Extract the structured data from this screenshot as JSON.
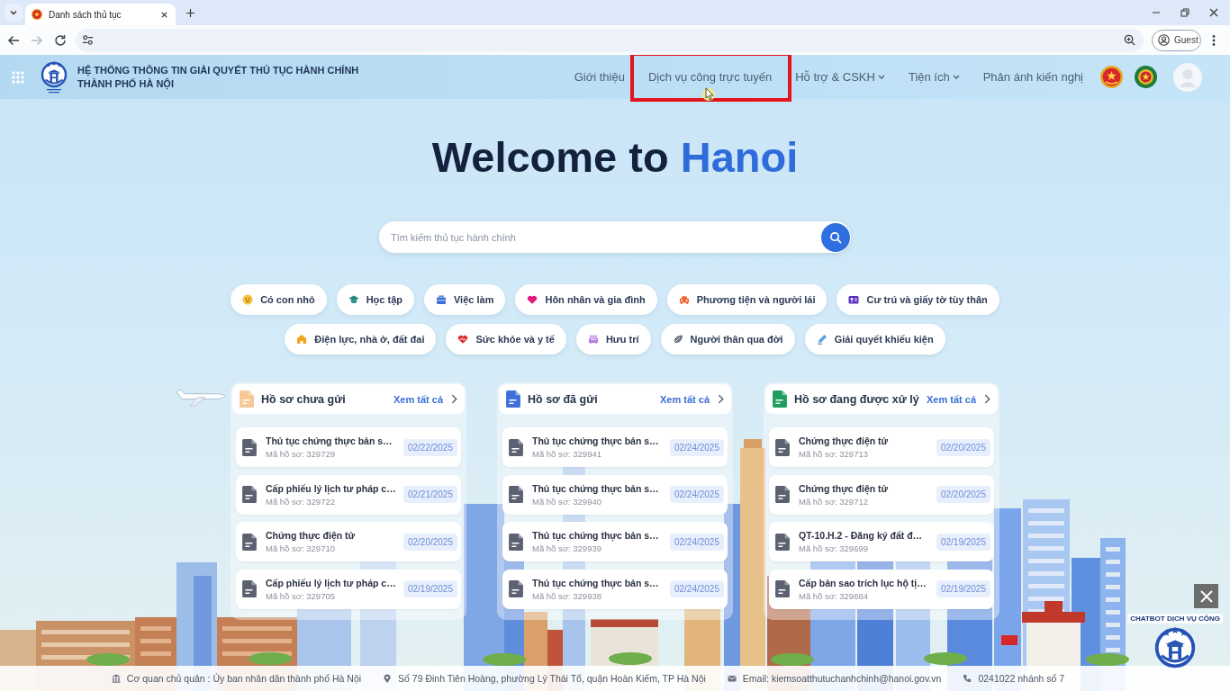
{
  "browser": {
    "tab_title": "Danh sách thủ tục",
    "forward_disabled": true,
    "profile": "Guest"
  },
  "header": {
    "title_lines": [
      "HỆ THỐNG THÔNG TIN GIẢI QUYẾT THỦ TỤC HÀNH CHÍNH",
      "THÀNH PHỐ HÀ NỘI"
    ],
    "nav": [
      {
        "label": "Giới thiệu",
        "dropdown": false,
        "highlighted": false
      },
      {
        "label": "Dịch vụ công trực tuyến",
        "dropdown": false,
        "highlighted": true
      },
      {
        "label": "Hỗ trợ & CSKH",
        "dropdown": true,
        "highlighted": false
      },
      {
        "label": "Tiện ích",
        "dropdown": true,
        "highlighted": false
      },
      {
        "label": "Phản ánh kiến nghị",
        "dropdown": false,
        "highlighted": false
      }
    ]
  },
  "hero": {
    "title": "Welcome to",
    "title_accent": "Hanoi"
  },
  "search": {
    "placeholder": "Tìm kiếm thủ tục hành chính"
  },
  "category_rows": [
    [
      "Có con nhỏ",
      "Học tập",
      "Việc làm",
      "Hôn nhân và gia đình",
      "Phương tiện và người lái",
      "Cư trú và giấy tờ tùy thân"
    ],
    [
      "Điện lực, nhà ở, đất đai",
      "Sức khỏe và y tế",
      "Hưu trí",
      "Người thân qua đời",
      "Giải quyết khiếu kiện"
    ]
  ],
  "cards": [
    {
      "title": "Hồ sơ chưa gửi",
      "link": "Xem tất cả",
      "color": "#f5c896",
      "items": [
        {
          "title": "Thủ tục chứng thực bản s…",
          "code": "Mã hồ sơ: 329729",
          "date": "02/22/2025"
        },
        {
          "title": "Cấp phiếu lý lịch tư pháp c…",
          "code": "Mã hồ sơ: 329722",
          "date": "02/21/2025"
        },
        {
          "title": "Chứng thực điện tử",
          "code": "Mã hồ sơ: 329710",
          "date": "02/20/2025"
        },
        {
          "title": "Cấp phiếu lý lịch tư pháp c…",
          "code": "Mã hồ sơ: 329705",
          "date": "02/19/2025"
        }
      ]
    },
    {
      "title": "Hồ sơ đã gửi",
      "link": "Xem tất cả",
      "color": "#3f6fd8",
      "items": [
        {
          "title": "Thủ tục chứng thực bản s…",
          "code": "Mã hồ sơ: 329941",
          "date": "02/24/2025"
        },
        {
          "title": "Thủ tục chứng thực bản s…",
          "code": "Mã hồ sơ: 329940",
          "date": "02/24/2025"
        },
        {
          "title": "Thủ tục chứng thực bản s…",
          "code": "Mã hồ sơ: 329939",
          "date": "02/24/2025"
        },
        {
          "title": "Thủ tục chứng thực bản s…",
          "code": "Mã hồ sơ: 329938",
          "date": "02/24/2025"
        }
      ]
    },
    {
      "title": "Hồ sơ đang được xử lý",
      "link": "Xem tất cả",
      "color": "#1f9d5c",
      "items": [
        {
          "title": "Chứng thực điện tử",
          "code": "Mã hồ sơ: 329713",
          "date": "02/20/2025"
        },
        {
          "title": "Chứng thực điện tử",
          "code": "Mã hồ sơ: 329712",
          "date": "02/20/2025"
        },
        {
          "title": "QT-10.H.2 - Đăng ký đất đ…",
          "code": "Mã hồ sơ: 329699",
          "date": "02/19/2025"
        },
        {
          "title": "Cấp bản sao trích lục hộ tị…",
          "code": "Mã hồ sơ: 329684",
          "date": "02/19/2025"
        }
      ]
    }
  ],
  "footer": {
    "items": [
      "Cơ quan chủ quản : Ủy ban nhân dân thành phố Hà Nội",
      "Số 79 Đinh Tiên Hoàng, phường Lý Thái Tổ, quận Hoàn Kiếm, TP Hà Nội",
      "Email: kiemsoatthutuchanhchinh@hanoi.gov.vn",
      "0241022 nhánh số 7"
    ]
  },
  "chatbot": {
    "label": "CHATBOT DỊCH VỤ CÔNG"
  }
}
